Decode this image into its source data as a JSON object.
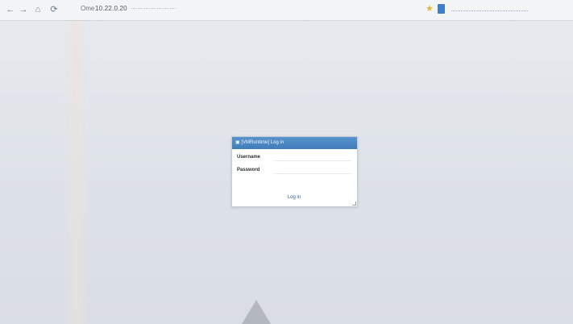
{
  "browser": {
    "address_page": "Ome",
    "address_host": "10.22.0.20",
    "nav_back": "←",
    "nav_forward": "→",
    "nav_home": "⌂",
    "nav_reload": "⟳"
  },
  "dialog": {
    "title": "▣ [VMRuntime] Log in",
    "username_label": "Username",
    "password_label": "Password",
    "login_label": "Log in"
  },
  "colors": {
    "dialog_header": "#4a88c4",
    "background": "#dfe3e8"
  }
}
